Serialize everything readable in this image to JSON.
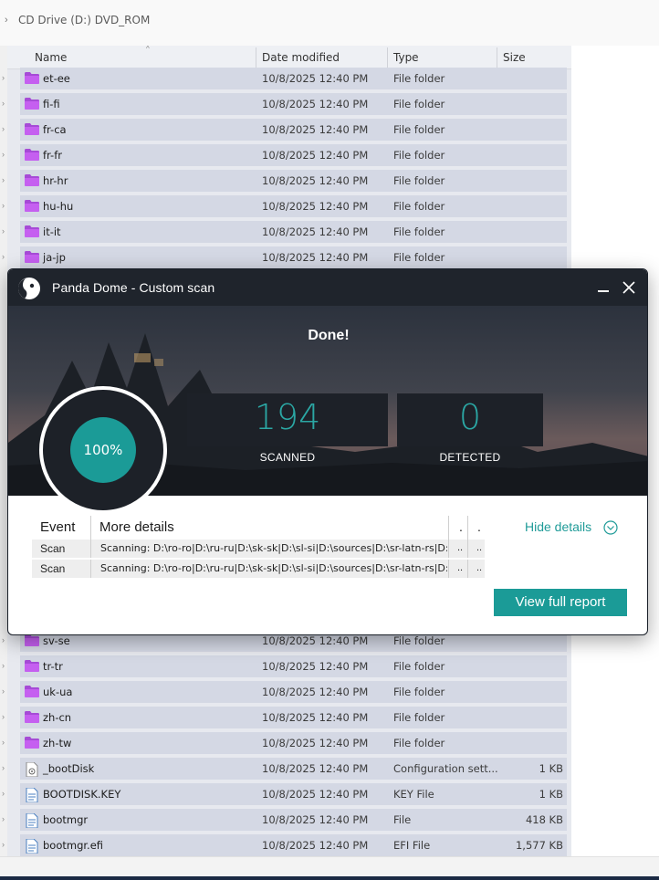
{
  "explorer": {
    "breadcrumb": "CD Drive (D:) DVD_ROM",
    "columns": [
      "Name",
      "Date modified",
      "Type",
      "Size"
    ],
    "rows_top": [
      {
        "name": "et-ee",
        "date": "10/8/2025 12:40 PM",
        "type": "File folder",
        "size": "",
        "icon": "folder-icon"
      },
      {
        "name": "fi-fi",
        "date": "10/8/2025 12:40 PM",
        "type": "File folder",
        "size": "",
        "icon": "folder-icon"
      },
      {
        "name": "fr-ca",
        "date": "10/8/2025 12:40 PM",
        "type": "File folder",
        "size": "",
        "icon": "folder-icon"
      },
      {
        "name": "fr-fr",
        "date": "10/8/2025 12:40 PM",
        "type": "File folder",
        "size": "",
        "icon": "folder-icon"
      },
      {
        "name": "hr-hr",
        "date": "10/8/2025 12:40 PM",
        "type": "File folder",
        "size": "",
        "icon": "folder-icon"
      },
      {
        "name": "hu-hu",
        "date": "10/8/2025 12:40 PM",
        "type": "File folder",
        "size": "",
        "icon": "folder-icon"
      },
      {
        "name": "it-it",
        "date": "10/8/2025 12:40 PM",
        "type": "File folder",
        "size": "",
        "icon": "folder-icon"
      },
      {
        "name": "ja-jp",
        "date": "10/8/2025 12:40 PM",
        "type": "File folder",
        "size": "",
        "icon": "folder-icon"
      }
    ],
    "rows_bottom": [
      {
        "name": "sv-se",
        "date": "10/8/2025 12:40 PM",
        "type": "File folder",
        "size": "",
        "icon": "folder-icon"
      },
      {
        "name": "tr-tr",
        "date": "10/8/2025 12:40 PM",
        "type": "File folder",
        "size": "",
        "icon": "folder-icon"
      },
      {
        "name": "uk-ua",
        "date": "10/8/2025 12:40 PM",
        "type": "File folder",
        "size": "",
        "icon": "folder-icon"
      },
      {
        "name": "zh-cn",
        "date": "10/8/2025 12:40 PM",
        "type": "File folder",
        "size": "",
        "icon": "folder-icon"
      },
      {
        "name": "zh-tw",
        "date": "10/8/2025 12:40 PM",
        "type": "File folder",
        "size": "",
        "icon": "folder-icon"
      },
      {
        "name": "_bootDisk",
        "date": "10/8/2025 12:40 PM",
        "type": "Configuration sett...",
        "size": "1 KB",
        "icon": "config-file-icon"
      },
      {
        "name": "BOOTDISK.KEY",
        "date": "10/8/2025 12:40 PM",
        "type": "KEY File",
        "size": "1 KB",
        "icon": "file-icon"
      },
      {
        "name": "bootmgr",
        "date": "10/8/2025 12:40 PM",
        "type": "File",
        "size": "418 KB",
        "icon": "file-icon"
      },
      {
        "name": "bootmgr.efi",
        "date": "10/8/2025 12:40 PM",
        "type": "EFI File",
        "size": "1,577 KB",
        "icon": "file-icon"
      }
    ]
  },
  "panda": {
    "title": "Panda Dome - Custom scan",
    "status": "Done!",
    "progress_label": "100%",
    "progress_value": 100,
    "scanned_count": "194",
    "scanned_label": "SCANNED",
    "detected_count": "0",
    "detected_label": "DETECTED",
    "details_header": {
      "event": "Event",
      "more": "More details",
      "col3": ".",
      "col4": "."
    },
    "details_rows": [
      {
        "event": "Scan",
        "details": "Scanning: D:\\ro-ro|D:\\ru-ru|D:\\sk-sk|D:\\sl-si|D:\\sources|D:\\sr-latn-rs|D:...",
        "c3": "..",
        "c4": ".."
      },
      {
        "event": "Scan",
        "details": "Scanning: D:\\ro-ro|D:\\ru-ru|D:\\sk-sk|D:\\sl-si|D:\\sources|D:\\sr-latn-rs|D:...",
        "c3": "..",
        "c4": ".."
      }
    ],
    "hide_details_label": "Hide details",
    "view_report_label": "View full report",
    "accent": "#1b9b97"
  }
}
